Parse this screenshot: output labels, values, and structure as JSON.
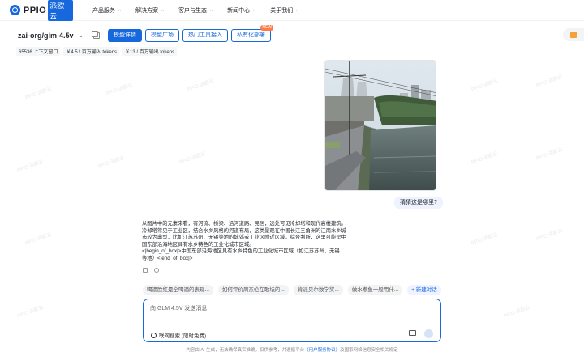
{
  "nav": {
    "logo_text": "PPIO",
    "logo_sub": "派欧云",
    "menu": [
      {
        "label": "产品服务"
      },
      {
        "label": "解决方案"
      },
      {
        "label": "客户与生态"
      },
      {
        "label": "新闻中心"
      },
      {
        "label": "关于我们"
      }
    ]
  },
  "toolbar": {
    "model_name": "zai-org/glm-4.5v",
    "tabs": [
      {
        "label": "模型详情",
        "active": true
      },
      {
        "label": "模型广场"
      },
      {
        "label": "热门工具接入"
      },
      {
        "label": "私有化部署",
        "badge": "NEW"
      }
    ]
  },
  "meta": {
    "context": "65536 上下文窗口",
    "input_price": "￥4.5 / 百万输入 tokens",
    "output_price": "￥13 / 百万输出 tokens"
  },
  "chat": {
    "user_message": "猜猜这是哪里?",
    "answer_lines": [
      "从图片中的元素来看，有河流、桥梁、沿河道路、民居，远处可见冷却塔和现代高楼建筑。",
      "冷却塔常见于工业区，结合水乡风格的河道布局，这类景观在中国长江三角洲的江南水乡城",
      "市较为典型，比如江苏苏州、无锡等地的城郊或工业区附近区域。综合判断，这里可能是中",
      "国东部沿海地区具有水乡特色的工业化城市区域。",
      "<|begin_of_box|>中国东部沿海地区具有水乡特色的工业化城市区域（如江苏苏州、无锡",
      "等地）<|end_of_box|>"
    ]
  },
  "suggestions": [
    "喝酒脸红是全喝酒的表现...",
    "如何评价周杰伦在歌坛的...",
    "肯派贝尔数学奖...",
    "做水煮鱼一般用什...",
    "+ 新建对话"
  ],
  "input": {
    "placeholder": "向 GLM 4.5V 发送消息",
    "search_label": "联网搜索 (限时免费)"
  },
  "footer": {
    "text": "内容由 AI 生成，无法确保真实准确，仅供参考，并遵循平台",
    "link": "《用户服务协议》",
    "text2": "及国家网络信息安全相关规定"
  },
  "watermark": "PPIO 派欧云"
}
